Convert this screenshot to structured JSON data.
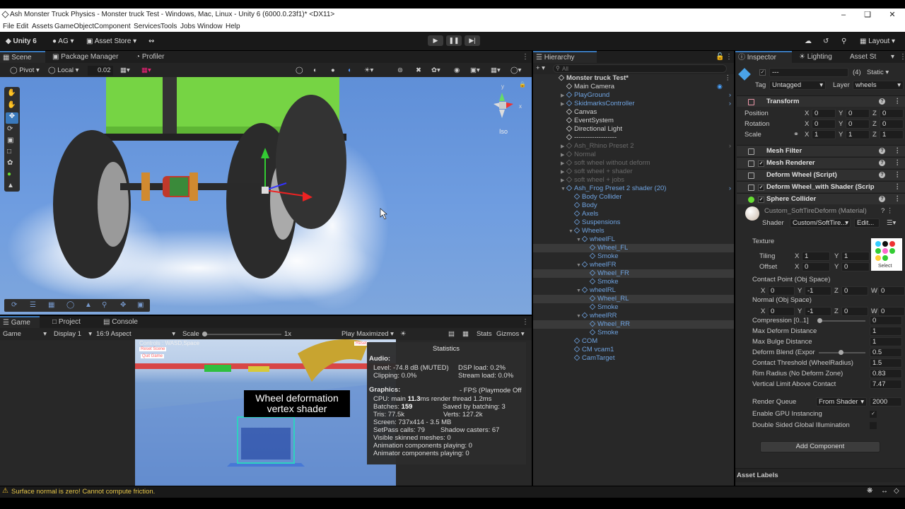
{
  "window": {
    "title": "Ash Monster Truck Physics - Monster truck Test - Windows, Mac, Linux - Unity 6 (6000.0.23f1)* <DX11>"
  },
  "menu": [
    "File",
    "Edit",
    "Assets",
    "GameObject",
    "Component",
    "Services",
    "Tools",
    "Jobs",
    "Window",
    "Help"
  ],
  "toolbar": {
    "unity": "Unity 6",
    "account": "AG",
    "asset_store": "Asset Store",
    "layout": "Layout"
  },
  "scene": {
    "tabs": [
      "Scene",
      "Package Manager",
      "Profiler"
    ],
    "pivot": "Pivot",
    "local": "Local",
    "snap": "0.02",
    "iso": "Iso"
  },
  "game": {
    "tabs": [
      "Game",
      "Project",
      "Console"
    ],
    "mode": "Game",
    "display": "Display 1",
    "aspect": "16:9 Aspect",
    "scale_label": "Scale",
    "scale_value": "1x",
    "play_max": "Play Maximized",
    "stats": "Stats",
    "gizmos": "Gizmos",
    "overlay_controls": "Controls : WASD,Space",
    "overlay_reset": "Reset Scene",
    "overlay_quit": "Quit Game",
    "caption_1": "Wheel deformation",
    "caption_2": "vertex shader",
    "reset_small": "Reset"
  },
  "statistics": {
    "title": "Statistics",
    "audio_h": "Audio:",
    "level": "Level: -74.8 dB (MUTED)",
    "dsp": "DSP load: 0.2%",
    "clipping": "Clipping: 0.0%",
    "stream": "Stream load: 0.0%",
    "graphics_h": "Graphics:",
    "fps": "- FPS (Playmode Off",
    "cpu_a": "CPU: main ",
    "cpu_b": "11.3",
    "cpu_c": "ms  render thread 1.2ms",
    "batches_a": "Batches: ",
    "batches_b": "159",
    "saved": "Saved by batching: 3",
    "tris": "Tris: 77.5k",
    "verts": "Verts: 127.2k",
    "screen": "Screen: 737x414 - 3.5 MB",
    "setpass": "SetPass calls: 79",
    "shadow": "Shadow casters: 67",
    "skinned": "Visible skinned meshes: 0",
    "anim": "Animation components playing: 0",
    "animator": "Animator components playing: 0"
  },
  "hierarchy": {
    "tab": "Hierarchy",
    "search_placeholder": "All",
    "rows": [
      {
        "t": "Monster truck Test*",
        "s": "root"
      },
      {
        "t": "Main Camera",
        "s": "n"
      },
      {
        "t": "PlayGround",
        "s": "b"
      },
      {
        "t": "SkidmarksController",
        "s": "b"
      },
      {
        "t": "Canvas",
        "s": "n"
      },
      {
        "t": "EventSystem",
        "s": "n"
      },
      {
        "t": "Directional Light",
        "s": "n"
      },
      {
        "t": "-------------------",
        "s": "n"
      },
      {
        "t": "Ash_Rhino Preset 2",
        "s": "d"
      },
      {
        "t": "Normal",
        "s": "d"
      },
      {
        "t": "soft wheel without deform",
        "s": "d"
      },
      {
        "t": "soft wheel + shader",
        "s": "d"
      },
      {
        "t": "soft wheel + jobs",
        "s": "d"
      },
      {
        "t": "Ash_Frog Preset 2 shader (20)",
        "s": "b"
      },
      {
        "t": "Body Collider",
        "s": "b"
      },
      {
        "t": "Body",
        "s": "b"
      },
      {
        "t": "Axels",
        "s": "b"
      },
      {
        "t": "Suspensions",
        "s": "b"
      },
      {
        "t": "Wheels",
        "s": "b"
      },
      {
        "t": "wheelFL",
        "s": "b"
      },
      {
        "t": "Wheel_FL",
        "s": "bs"
      },
      {
        "t": "Smoke",
        "s": "b"
      },
      {
        "t": "wheelFR",
        "s": "b"
      },
      {
        "t": "Wheel_FR",
        "s": "bs"
      },
      {
        "t": "Smoke",
        "s": "b"
      },
      {
        "t": "wheelRL",
        "s": "b"
      },
      {
        "t": "Wheel_RL",
        "s": "bs"
      },
      {
        "t": "Smoke",
        "s": "b"
      },
      {
        "t": "wheelRR",
        "s": "b"
      },
      {
        "t": "Wheel_RR",
        "s": "bs"
      },
      {
        "t": "Smoke",
        "s": "b"
      },
      {
        "t": "COM",
        "s": "b"
      },
      {
        "t": "CM vcam1",
        "s": "b"
      },
      {
        "t": "CamTarget",
        "s": "b"
      }
    ]
  },
  "inspector": {
    "tabs": [
      "Inspector",
      "Lighting",
      "Asset St"
    ],
    "name": "---",
    "multi": "(4)",
    "static": "Static",
    "tag_l": "Tag",
    "tag": "Untagged",
    "layer_l": "Layer",
    "layer": "wheels",
    "transform": "Transform",
    "pos_l": "Position",
    "rot_l": "Rotation",
    "scale_l": "Scale",
    "pos": [
      "0",
      "0",
      "0"
    ],
    "rot": [
      "0",
      "0",
      "0"
    ],
    "scale": [
      "1",
      "1",
      "1"
    ],
    "comps": [
      "Mesh Filter",
      "Mesh Renderer",
      "Deform Wheel (Script)",
      "Deform Wheel_with Shader (Scrip",
      "Sphere Collider"
    ],
    "material": "Custom_SoftTireDeform (Material)",
    "shader_l": "Shader",
    "shader": "Custom/SoftTire...",
    "edit": "Edit...",
    "texture": "Texture",
    "tiling_l": "Tiling",
    "tiling": [
      "1",
      "1"
    ],
    "offset_l": "Offset",
    "offset": [
      "0",
      "0"
    ],
    "select": "Select",
    "contact_l": "Contact Point (Obj Space)",
    "contact": [
      "0",
      "-1",
      "0",
      "0"
    ],
    "normal_l": "Normal (Obj Space)",
    "normal": [
      "0",
      "-1",
      "0",
      "0"
    ],
    "props": [
      {
        "l": "Compression [0..1]",
        "v": "0",
        "slider": 0.0
      },
      {
        "l": "Max Deform Distance",
        "v": "1"
      },
      {
        "l": "Max Bulge Distance",
        "v": "1"
      },
      {
        "l": "Deform Blend (Expor",
        "v": "0.5",
        "slider": 0.5
      },
      {
        "l": "Contact Threshold (WheelRadius)",
        "v": "1.5"
      },
      {
        "l": "Rim Radius (No Deform Zone)",
        "v": "0.83"
      },
      {
        "l": "Vertical Limit Above Contact",
        "v": "7.47"
      }
    ],
    "rq_l": "Render Queue",
    "rq_mode": "From Shader",
    "rq": "2000",
    "gpu_l": "Enable GPU Instancing",
    "dsgi_l": "Double Sided Global Illumination",
    "add": "Add Component",
    "labels": "Asset Labels"
  },
  "status": {
    "warning": "Surface normal is zero! Cannot compute friction."
  }
}
